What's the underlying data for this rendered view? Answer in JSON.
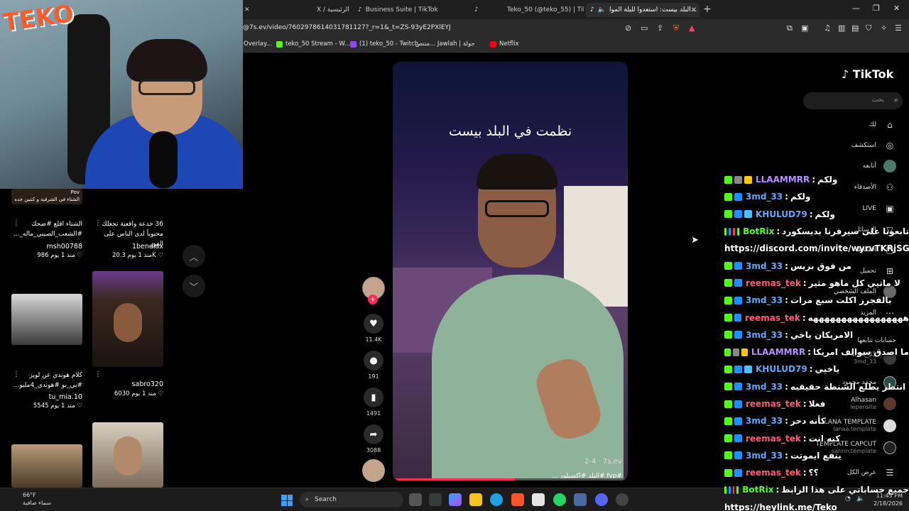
{
  "browser": {
    "tabs": [
      {
        "label": "X / الرئيسية",
        "active": false
      },
      {
        "label": "Business Suite | TikTok",
        "active": false
      },
      {
        "label": "",
        "active": false
      },
      {
        "label": "Teko_50 (@teko_55) | TikTok",
        "active": false
      },
      {
        "label": "البلد بيست: استعدوا لليلة الموا...",
        "active": true
      }
    ],
    "url": "@7s.ev/video/7602978614031781127?_r=1&_t=ZS-93yE2PXlEYJ",
    "bookmarks": [
      {
        "label": "Overlay...",
        "color": "#888888"
      },
      {
        "label": "teko_50 Stream - W...",
        "color": "#53fc18"
      },
      {
        "label": "(1) teko_50 - Twitch",
        "color": "#9146ff"
      },
      {
        "label": "منتص... Jawlah | جولة",
        "color": "#444444"
      },
      {
        "label": "Netflix",
        "color": "#e50914"
      }
    ]
  },
  "webcam": {
    "logo": "TEKO"
  },
  "grid": [
    {
      "caption": "Pov\nالشتاء في الشرقية و كنتين جده",
      "user": "",
      "likes": "",
      "age": ""
    },
    {
      "caption": "الشتاء اقلع #ضحك #الشعب_الصيني_ماله_...",
      "user": "msh00788",
      "likes": "986",
      "age": "منذ 1 يوم"
    },
    {
      "caption": "36 خدعة واقعية تجعلك محبوباً لدى الناس على الفور",
      "user": "1bendiax",
      "likes": "20.3K",
      "age": "منذ 1 يوم"
    },
    {
      "caption": "كلام هوندي عن لويز #بي_بو #هوندي_4مليو...",
      "user": "tu_mia.10",
      "likes": "5545",
      "age": "منذ 1 يوم"
    },
    {
      "caption": "",
      "user": "sabro320",
      "likes": "6030",
      "age": "منذ 1 يوم"
    }
  ],
  "video": {
    "title": "نظمت في البلد بيست",
    "tag": "2-4 · 7s.ev",
    "caption": "#fyp #البلد #اكسبلور ...",
    "progress": 0.52,
    "actions": {
      "likes": "11.4K",
      "comments": "191",
      "saves": "1491",
      "shares": "3088"
    }
  },
  "tiktok": {
    "logo": "TikTok",
    "search_placeholder": "بحث",
    "nav": [
      {
        "label": "لك",
        "icon": "home-icon"
      },
      {
        "label": "استكشف",
        "icon": "compass-icon"
      },
      {
        "label": "أتابعه",
        "icon": "following-icon"
      },
      {
        "label": "الأصدقاء",
        "icon": "friends-icon"
      },
      {
        "label": "LIVE",
        "icon": "live-icon"
      },
      {
        "label": "الرسائل",
        "icon": "messages-icon"
      },
      {
        "label": "النشاط",
        "icon": "activity-icon"
      },
      {
        "label": "تحميل",
        "icon": "upload-icon"
      },
      {
        "label": "الملف الشخصي",
        "icon": "profile-icon"
      },
      {
        "label": "المزيد",
        "icon": "more-icon"
      }
    ],
    "following_header": "حسابات تتابعها",
    "following": [
      {
        "name": "3md_33",
        "handle": "3md_33"
      },
      {
        "name": "محمد محمود",
        "handle": ""
      },
      {
        "name": "Alhasan",
        "handle": "lepensite"
      },
      {
        "name": "LANA TEMPLATE",
        "handle": "lanaa.template"
      },
      {
        "name": "TEMPLATE CAPCUT",
        "handle": "sannn.template"
      }
    ],
    "see_all": "عرض الكل"
  },
  "chat": [
    {
      "user": "LLAAMMRR",
      "color": "#b98cff",
      "msg": "ولكم",
      "badges": [
        "#53fc18",
        "#888888",
        "#f5c518"
      ]
    },
    {
      "user": "3md_33",
      "color": "#5fa8ff",
      "msg": "ولكم",
      "badges": [
        "#53fc18",
        "#1e90ff"
      ]
    },
    {
      "user": "KHULUD79",
      "color": "#5fa8ff",
      "msg": "ولكم",
      "badges": [
        "#53fc18",
        "#1e90ff",
        "#4ac0ff"
      ]
    },
    {
      "user": "BotRix",
      "color": "#53fc18",
      "msg": "تابعونا على سيرفرنا بديسكورد",
      "badges": [
        "#53fc18",
        "#1e90ff",
        "#ff3d3d",
        "#53fc18"
      ]
    },
    {
      "link": "https://discord.com/invite/wyrvTKRjSG"
    },
    {
      "user": "3md_33",
      "color": "#5fa8ff",
      "msg": "من فوق بريس",
      "badges": [
        "#53fc18",
        "#1e90ff"
      ]
    },
    {
      "user": "reemas_tek",
      "color": "#ff5a7a",
      "msg": "لا ماتيي كل ماهو مثير",
      "badges": [
        "#53fc18",
        "#1e90ff"
      ]
    },
    {
      "user": "3md_33",
      "color": "#5fa8ff",
      "msg": "بالفجرز اكلت سبع مرات",
      "badges": [
        "#53fc18",
        "#1e90ff"
      ]
    },
    {
      "user": "reemas_tek",
      "color": "#ff5a7a",
      "msg": "هههههههههههههههههه",
      "badges": [
        "#53fc18",
        "#1e90ff"
      ]
    },
    {
      "user": "3md_33",
      "color": "#5fa8ff",
      "msg": "الامريكان ياخي",
      "badges": [
        "#53fc18",
        "#1e90ff"
      ]
    },
    {
      "user": "LLAAMMRR",
      "color": "#b98cff",
      "msg": "ما اصدق سوالف امريكا",
      "badges": [
        "#53fc18",
        "#888888",
        "#f5c518"
      ]
    },
    {
      "user": "KHULUD79",
      "color": "#5fa8ff",
      "msg": "ياخيي",
      "badges": [
        "#53fc18",
        "#1e90ff",
        "#4ac0ff"
      ]
    },
    {
      "user": "3md_33",
      "color": "#5fa8ff",
      "msg": "انتظر يطلع الشنطة حقيقيه",
      "badges": [
        "#53fc18",
        "#1e90ff"
      ]
    },
    {
      "user": "reemas_tek",
      "color": "#ff5a7a",
      "msg": "فعلا",
      "badges": [
        "#53fc18",
        "#1e90ff"
      ]
    },
    {
      "user": "3md_33",
      "color": "#5fa8ff",
      "msg": "كأنه دحر",
      "badges": [
        "#53fc18",
        "#1e90ff"
      ]
    },
    {
      "user": "reemas_tek",
      "color": "#ff5a7a",
      "msg": "كنه انت",
      "badges": [
        "#53fc18",
        "#1e90ff"
      ]
    },
    {
      "user": "3md_33",
      "color": "#5fa8ff",
      "msg": "ينفع ايموتت",
      "badges": [
        "#53fc18",
        "#1e90ff"
      ]
    },
    {
      "user": "reemas_tek",
      "color": "#ff5a7a",
      "msg": "؟؟",
      "badges": [
        "#53fc18",
        "#1e90ff"
      ]
    },
    {
      "user": "BotRix",
      "color": "#53fc18",
      "msg": "جميع حساباتي على هذا الرابط",
      "badges": [
        "#53fc18",
        "#1e90ff",
        "#ff3d3d",
        "#53fc18"
      ]
    },
    {
      "link": "https://heylink.me/Teko"
    }
  ],
  "taskbar": {
    "weather_temp": "66°F",
    "weather_desc": "سماء صافية",
    "search": "Search",
    "time": "11:49 PM",
    "date": "2/18/2026"
  }
}
